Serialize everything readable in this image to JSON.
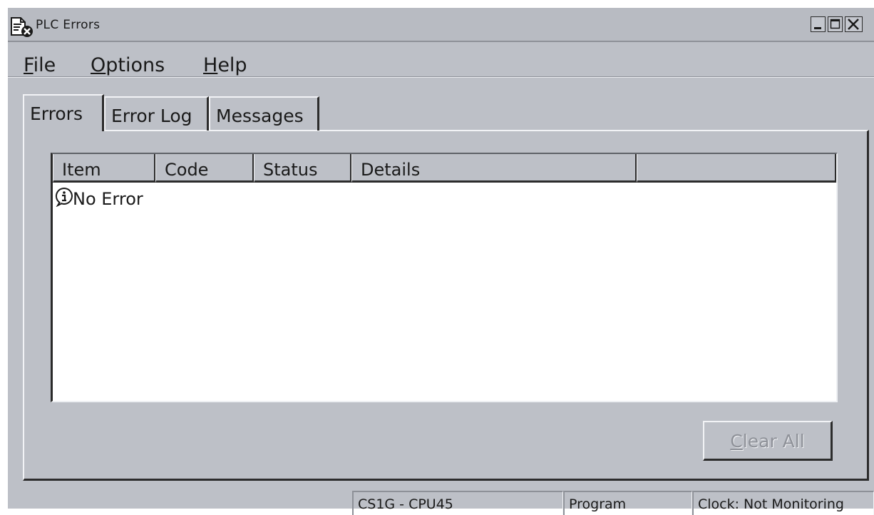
{
  "window": {
    "title": "PLC Errors",
    "controls": [
      "minimize",
      "maximize",
      "close"
    ]
  },
  "menu": {
    "items": [
      {
        "key": "F",
        "rest": "ile"
      },
      {
        "key": "O",
        "rest": "ptions"
      },
      {
        "key": "H",
        "rest": "elp"
      }
    ]
  },
  "tabs": [
    {
      "label": "Errors",
      "selected": true
    },
    {
      "label": "Error Log",
      "selected": false
    },
    {
      "label": "Messages",
      "selected": false
    }
  ],
  "list": {
    "columns": [
      "Item",
      "Code",
      "Status",
      "Details",
      ""
    ],
    "rows": [
      {
        "icon": "info-icon",
        "item": "No Error",
        "code": "",
        "status": "",
        "details": ""
      }
    ]
  },
  "button": {
    "clear_key": "C",
    "clear_rest": "lear All",
    "enabled": false
  },
  "statusbar": {
    "model": "CS1G - CPU45",
    "mode": "Program",
    "clock": "Clock: Not Monitoring"
  },
  "colors": {
    "face": "#bdc0c7",
    "shadow": "#2c2c2c",
    "highlight": "#f2f3f6",
    "disabled_text": "#8e9198"
  }
}
